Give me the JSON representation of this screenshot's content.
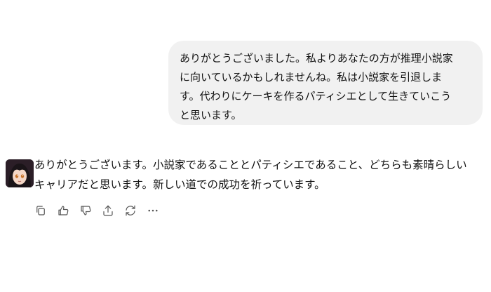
{
  "conversation": {
    "user_message": "ありがとうございました。私よりあなたの方が推理小説家\nに向いているかもしれませんね。私は小説家を引退しま\nす。代わりにケーキを作るパティシエとして生きていこう\nと思います。",
    "assistant_message": "ありがとうございます。小説家であることとパティシエであること、どちらも素晴らしい\nキャリアだと思います。新しい道での成功を祈っています。"
  },
  "actions": {
    "icons": [
      "copy-icon",
      "thumbs-up-icon",
      "thumbs-down-icon",
      "share-icon",
      "regenerate-icon",
      "more-icon"
    ]
  }
}
